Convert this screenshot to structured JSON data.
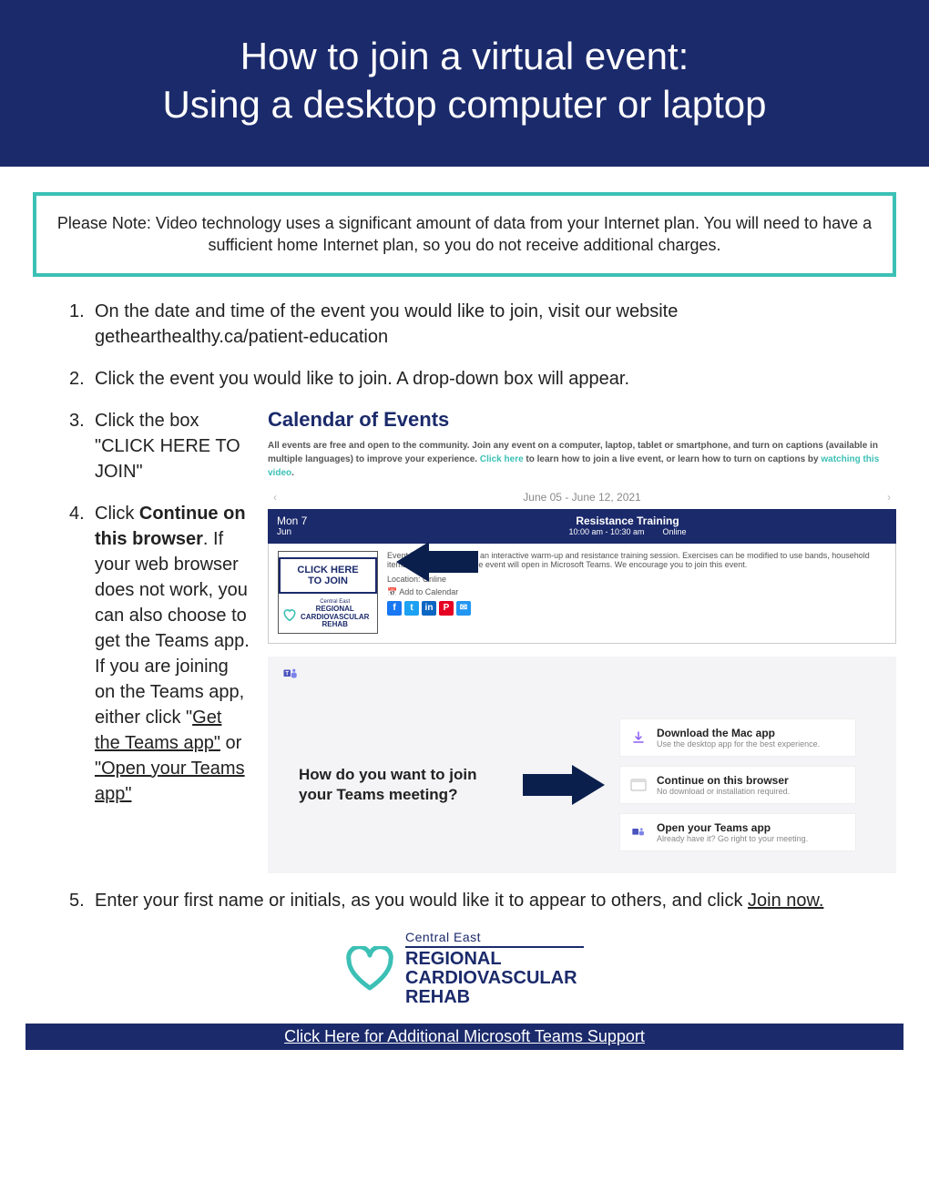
{
  "header": {
    "line1": "How to join a virtual event:",
    "line2": "Using a desktop computer or laptop"
  },
  "note": "Please Note: Video technology uses a significant amount of data from your Internet plan. You will need to have a sufficient home Internet plan, so you do not receive additional charges.",
  "steps": {
    "s1_num": "1.",
    "s1": "On the date and time of the event you would like to join, visit our website gethearthealthy.ca/patient-education",
    "s2_num": "2.",
    "s2": " Click the event you would like to join. A drop-down box will appear.",
    "s3_num": "3.",
    "s3": "Click the box \"CLICK HERE TO JOIN\"",
    "s4_num": "4.",
    "s4_a": "Click ",
    "s4_bold": "Continue on this browser",
    "s4_b": ". If your web browser does not work, you can also choose to get the Teams app. If you are joining on the Teams app, either click \"",
    "s4_u1": "Get the Teams app\"",
    "s4_c": " or",
    "s4_u2": " \"Open your Teams app\"",
    "s5_num": "5.",
    "s5_a": "Enter your first name or initials, as you would like it to appear to others, and click ",
    "s5_u": "Join now."
  },
  "calendar": {
    "title": "Calendar of Events",
    "desc_a": "All events are free and open to the community. Join any event on a computer, laptop, tablet or smartphone, and turn on captions (available in multiple languages) to improve your experience. ",
    "desc_link1": "Click here",
    "desc_b": " to learn how to join a live event, or learn how to turn on captions by ",
    "desc_link2": "watching this video",
    "desc_c": ".",
    "date_range": "June 05 - June 12, 2021",
    "nav_prev": "‹",
    "nav_next": "›",
    "event": {
      "day": "Mon 7",
      "month": "Jun",
      "title": "Resistance Training",
      "time": "10:00 am - 10:30 am",
      "mode": "Online",
      "join_l1": "CLICK HERE",
      "join_l2": "TO JOIN",
      "org_ce": "Central East",
      "org_l1": "REGIONAL",
      "org_l2": "CARDIOVASCULAR",
      "org_l3": "REHAB",
      "details": "Event Details: Join us for an interactive warm-up and resistance training session. Exercises can be modified to use bands, household items, or body weight. The event will open in Microsoft Teams. We encourage you to join this event.",
      "location": "Location: Online",
      "add_cal": "📅 Add to Calendar"
    }
  },
  "teams": {
    "question": "How do you want to join your Teams meeting?",
    "opt1_t": "Download the Mac app",
    "opt1_s": "Use the desktop app for the best experience.",
    "opt2_t": "Continue on this browser",
    "opt2_s": "No download or installation required.",
    "opt3_t": "Open your Teams app",
    "opt3_s": "Already have it? Go right to your meeting."
  },
  "logo": {
    "ce": "Central East",
    "l1": "REGIONAL",
    "l2": "CARDIOVASCULAR",
    "l3": "REHAB"
  },
  "footer": "Click Here for Additional Microsoft Teams Support"
}
